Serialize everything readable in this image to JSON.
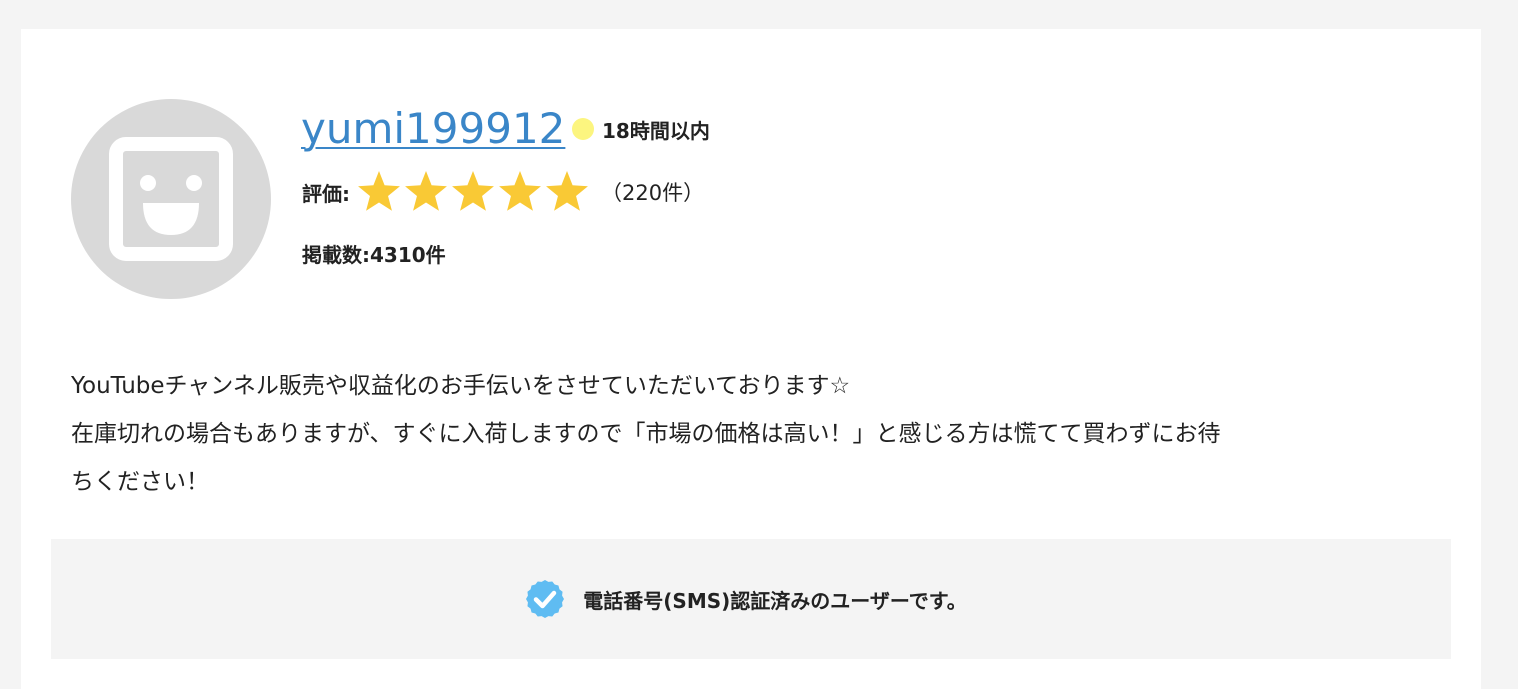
{
  "profile": {
    "username": "yumi199912",
    "status_text": "18時間以内",
    "status_color": "#fcf57f",
    "rating_label": "評価:",
    "rating_stars": 5,
    "rating_max": 5,
    "review_count": "（220件）",
    "listings_text": "掲載数:4310件",
    "avatar_icon": "smiley-placeholder-icon"
  },
  "bio": {
    "lines": [
      "YouTubeチャンネル販売や収益化のお手伝いをさせていただいております☆",
      "在庫切れの場合もありますが、すぐに入荷しますので「市場の価格は高い！」と感じる方は慌てて買わずにお待",
      "ちください！"
    ]
  },
  "verification": {
    "icon": "check-badge-icon",
    "text": "電話番号(SMS)認証済みのユーザーです。"
  },
  "colors": {
    "link": "#3a86c8",
    "star": "#f9c935",
    "badge": "#5fbcf2",
    "page_bg": "#f4f4f4"
  }
}
